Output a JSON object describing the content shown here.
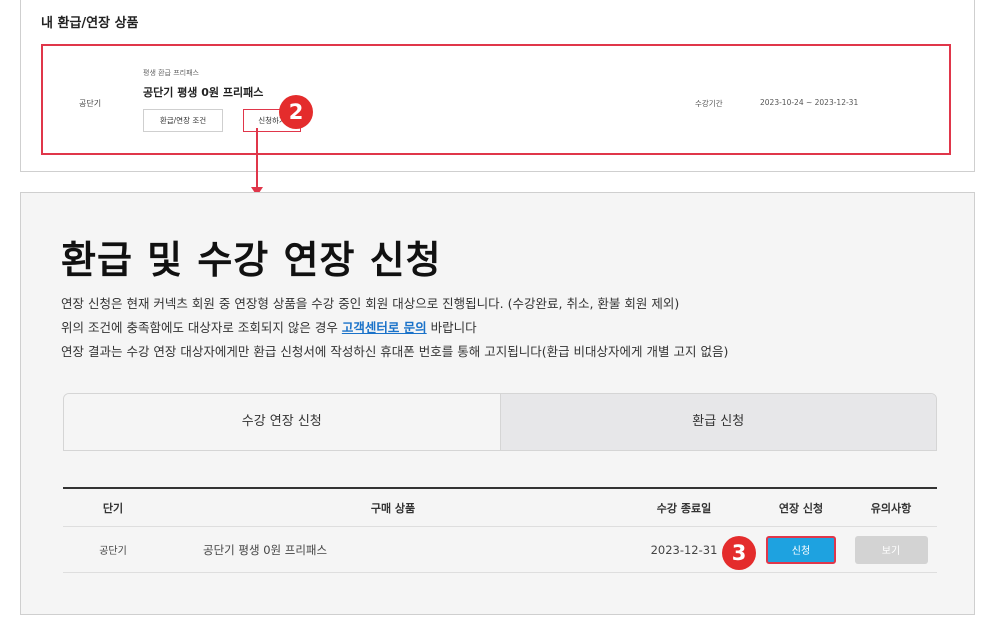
{
  "top": {
    "title": "내 환급/연장 상품",
    "tier": "공단기",
    "category": "평생 환급 프리패스",
    "product_name": "공단기 평생 0원 프리패스",
    "btn_conditions": "환급/연장 조건",
    "btn_apply": "신청하기",
    "period_label": "수강기간",
    "period": "2023-10-24 ~ 2023-12-31",
    "step_badge": "2"
  },
  "main": {
    "title": "환급 및 수강 연장 신청",
    "desc1": "연장 신청은 현재 커넥츠 회원 중 연장형 상품을 수강 중인 회원 대상으로 진행됩니다. (수강완료, 취소, 환불 회원 제외)",
    "desc2_pre": "위의 조건에 충족함에도 대상자로 조회되지 않은 경우 ",
    "desc2_link": "고객센터로 문의",
    "desc2_post": " 바랍니다",
    "desc3": "연장 결과는 수강 연장 대상자에게만 환급 신청서에 작성하신 휴대폰 번호를 통해 고지됩니다(환급 비대상자에게 개별 고지 없음)",
    "tabs": [
      {
        "label": "수강 연장 신청"
      },
      {
        "label": "환급 신청"
      }
    ],
    "table": {
      "headers": [
        "단기",
        "구매 상품",
        "수강 종료일",
        "연장 신청",
        "유의사항"
      ],
      "rows": [
        {
          "tier": "공단기",
          "product": "공단기 평생 0원 프리패스",
          "end_date": "2023-12-31",
          "apply": "신청",
          "view": "보기"
        }
      ]
    },
    "step_badge": "3"
  },
  "colors": {
    "highlight": "#e0364a",
    "link": "#1a72c9",
    "apply_button": "#1ea2e0"
  }
}
